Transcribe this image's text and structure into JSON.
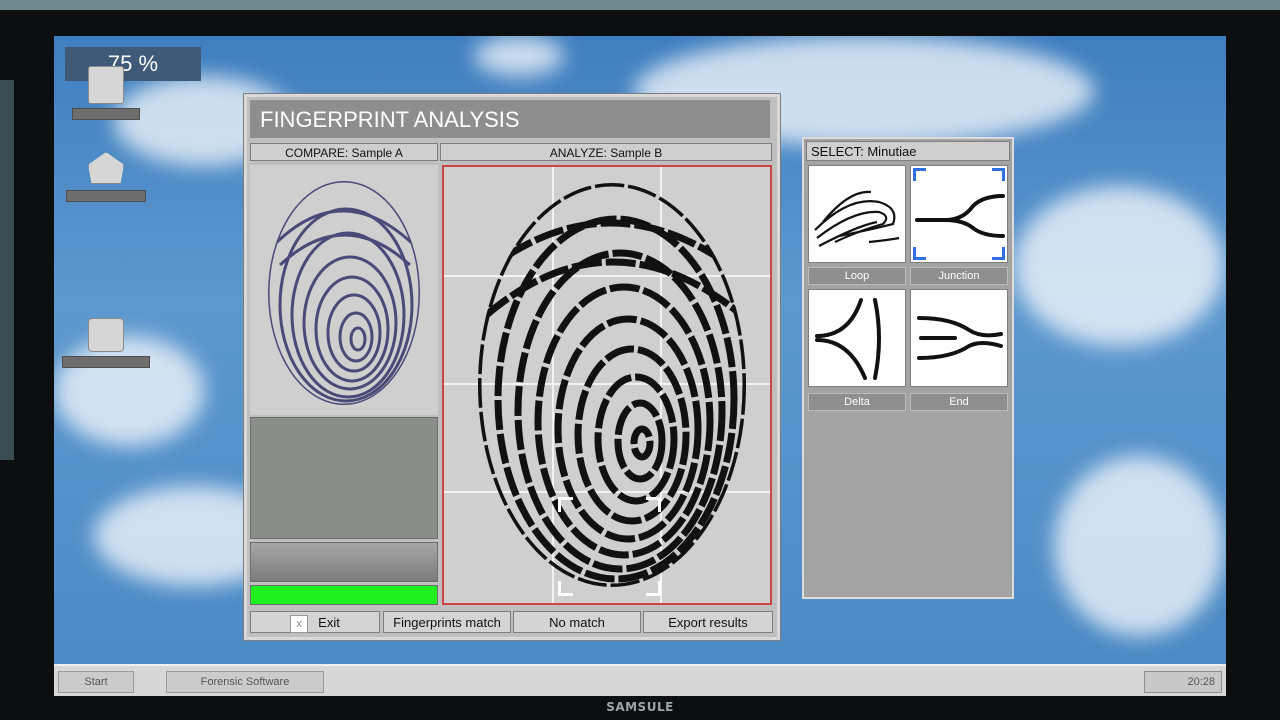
{
  "monitor": {
    "brand": "SAMSULE"
  },
  "desktop": {
    "progress_text": "75 %",
    "icons": [
      {
        "name": "document-icon"
      },
      {
        "name": "house-icon"
      },
      {
        "name": "computer-icon"
      }
    ]
  },
  "window": {
    "title": "FINGERPRINT ANALYSIS",
    "compare_header": "COMPARE: Sample A",
    "analyze_header": "ANALYZE: Sample B",
    "match_level": 1.0,
    "buttons": {
      "exit": "Exit",
      "exit_icon": "x",
      "match": "Fingerprints match",
      "no_match": "No match",
      "export": "Export results"
    }
  },
  "minutiae": {
    "header": "SELECT: Minutiae",
    "options": [
      {
        "label": "Loop",
        "icon": "loop-icon",
        "selected": false
      },
      {
        "label": "Junction",
        "icon": "junction-icon",
        "selected": true
      },
      {
        "label": "Delta",
        "icon": "delta-icon",
        "selected": false
      },
      {
        "label": "End",
        "icon": "end-icon",
        "selected": false
      }
    ]
  },
  "taskbar": {
    "start": "Start",
    "app": "Forensic Software",
    "clock": "20:28"
  },
  "colors": {
    "match_bar": "#20f020",
    "selection": "#2f6fe0",
    "sample_b_border": "#cc4444"
  }
}
